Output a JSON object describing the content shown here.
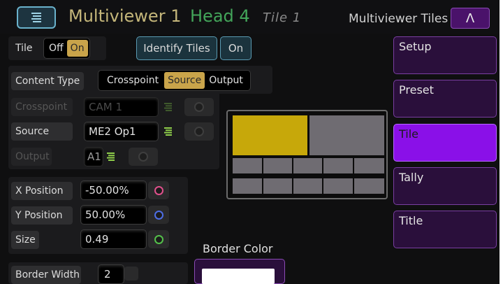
{
  "header": {
    "title": "Multiviewer 1",
    "head": "Head 4",
    "tile": "Tile 1",
    "right_label": "Multiviewer Tiles",
    "caret": "Λ"
  },
  "tile_row": {
    "label": "Tile",
    "options": [
      "Off",
      "On"
    ],
    "selected": "On",
    "identify_label": "Identify Tiles",
    "identify_state": "On"
  },
  "content_type": {
    "label": "Content Type",
    "options": [
      "Crosspoint",
      "Source",
      "Output"
    ],
    "selected": "Source"
  },
  "crosspoint": {
    "label": "Crosspoint",
    "value": "CAM 1"
  },
  "source": {
    "label": "Source",
    "value": "ME2 Op1"
  },
  "output": {
    "label": "Output",
    "value": "A1"
  },
  "x_position": {
    "label": "X Position",
    "value": "-50.00%",
    "dot_color": "#e0508c"
  },
  "y_position": {
    "label": "Y Position",
    "value": "50.00%",
    "dot_color": "#4e6ee6"
  },
  "size": {
    "label": "Size",
    "value": "0.49",
    "dot_color": "#54c04a"
  },
  "border_width": {
    "label": "Border Width",
    "value": "2"
  },
  "border_color": {
    "label": "Border Color",
    "swatch": "#ffffff"
  },
  "sidebar": {
    "items": [
      {
        "label": "Setup"
      },
      {
        "label": "Preset"
      },
      {
        "label": "Tile"
      },
      {
        "label": "Tally"
      },
      {
        "label": "Title"
      }
    ],
    "active": "Tile"
  },
  "layout_preview": {
    "selected_tile_color": "#c7a80a",
    "tile_color": "#6f6c72"
  },
  "colors": {
    "accent_purple": "#8a10e8",
    "accent_gold": "#c9a44a",
    "accent_teal": "#5a9bb3"
  }
}
